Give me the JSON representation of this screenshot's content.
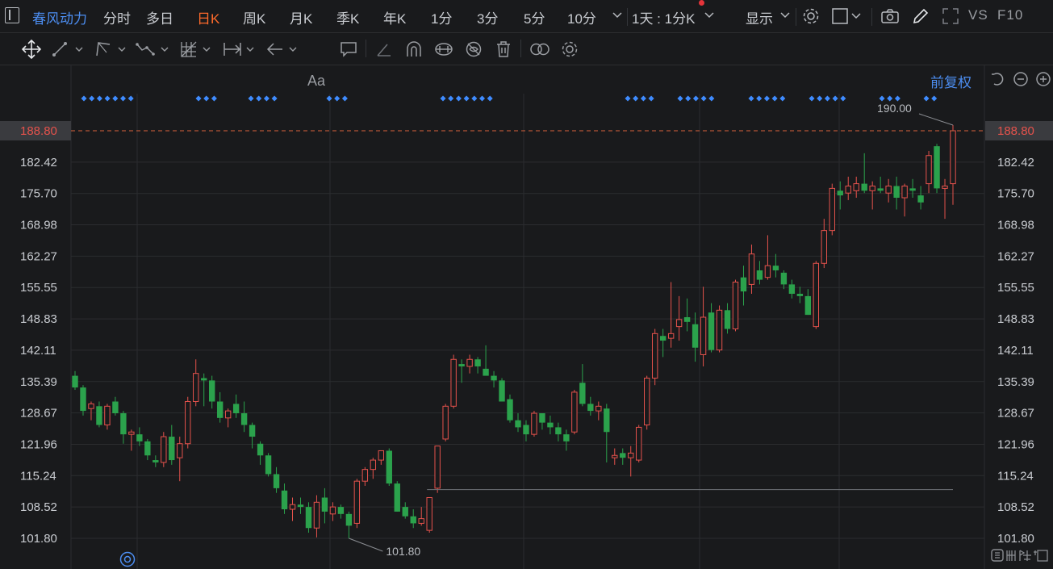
{
  "toolbar": {
    "stock_name": "春风动力",
    "periods": [
      "分时",
      "多日",
      "日K",
      "周K",
      "月K",
      "季K",
      "年K",
      "1分",
      "3分",
      "5分",
      "10分"
    ],
    "active_period": "日K",
    "combo": "1天 : 1分K",
    "display_label": "显示",
    "vs_label": "VS",
    "f10_label": "F10"
  },
  "drawing_tools": {
    "font_label": "Aa",
    "icons": [
      "move-icon",
      "line-segment-icon",
      "polyline-icon",
      "wave-icon",
      "fib-grid-icon",
      "measure-icon",
      "arrow-icon",
      "text-icon",
      "comment-icon",
      "angle-icon",
      "arc-icon",
      "magnet-icon",
      "hide-icon",
      "trash-icon",
      "link-icon",
      "settings-icon"
    ]
  },
  "adjust_label": "前复权",
  "colors": {
    "up": "#e5524c",
    "down": "#2ba24c",
    "accent": "#4c8df0",
    "active": "#ff6a2b",
    "grid": "#2b2c2f",
    "marker": "#3f8cff"
  },
  "chart_data": {
    "type": "candlestick",
    "y_ticks": [
      "188.80",
      "182.42",
      "175.70",
      "168.98",
      "162.27",
      "155.55",
      "148.83",
      "142.11",
      "135.39",
      "128.67",
      "121.96",
      "115.24",
      "108.52",
      "101.80"
    ],
    "ylim": [
      101.8,
      188.8
    ],
    "current_price": "188.80",
    "max_label": "190.00",
    "min_label": "101.80",
    "reference_line": 112.2,
    "candles": [
      [
        136.5,
        137.5,
        133.5,
        134.0
      ],
      [
        134.0,
        134.5,
        128.0,
        129.0
      ],
      [
        129.5,
        131.0,
        127.0,
        130.5
      ],
      [
        130.0,
        131.0,
        125.5,
        126.0
      ],
      [
        126.0,
        130.5,
        125.0,
        130.0
      ],
      [
        131.0,
        132.0,
        128.0,
        128.5
      ],
      [
        128.5,
        129.0,
        122.0,
        124.0
      ],
      [
        124.0,
        125.0,
        120.5,
        124.5
      ],
      [
        124.0,
        125.5,
        121.5,
        122.5
      ],
      [
        122.5,
        123.0,
        118.5,
        119.5
      ],
      [
        118.5,
        119.5,
        117.0,
        118.0
      ],
      [
        118.0,
        124.5,
        117.0,
        123.5
      ],
      [
        123.5,
        126.0,
        117.5,
        118.5
      ],
      [
        119.0,
        123.5,
        114.0,
        122.0
      ],
      [
        122.0,
        132.0,
        121.0,
        131.0
      ],
      [
        131.0,
        140.0,
        130.0,
        137.0
      ],
      [
        136.0,
        137.0,
        130.0,
        135.5
      ],
      [
        135.5,
        136.5,
        129.5,
        131.0
      ],
      [
        131.0,
        133.0,
        126.5,
        127.5
      ],
      [
        127.5,
        129.5,
        125.5,
        129.0
      ],
      [
        130.5,
        132.5,
        127.5,
        128.5
      ],
      [
        128.5,
        131.0,
        124.5,
        126.0
      ],
      [
        126.0,
        126.5,
        121.0,
        123.5
      ],
      [
        122.0,
        122.5,
        117.5,
        119.5
      ],
      [
        119.5,
        120.0,
        115.0,
        115.5
      ],
      [
        115.5,
        117.0,
        111.5,
        112.5
      ],
      [
        112.0,
        113.5,
        107.0,
        108.0
      ],
      [
        108.0,
        110.5,
        105.5,
        109.0
      ],
      [
        109.0,
        110.5,
        107.0,
        108.5
      ],
      [
        108.5,
        109.5,
        103.0,
        104.0
      ],
      [
        104.0,
        111.0,
        102.0,
        109.5
      ],
      [
        110.5,
        112.5,
        105.0,
        107.5
      ],
      [
        107.0,
        109.5,
        105.5,
        108.5
      ],
      [
        108.5,
        109.0,
        106.0,
        107.0
      ],
      [
        107.0,
        107.5,
        101.8,
        104.5
      ],
      [
        105.0,
        114.5,
        104.0,
        114.0
      ],
      [
        114.0,
        117.0,
        113.0,
        116.5
      ],
      [
        116.5,
        119.0,
        114.5,
        118.5
      ],
      [
        118.5,
        120.5,
        117.5,
        120.5
      ],
      [
        120.5,
        121.0,
        113.0,
        113.5
      ],
      [
        113.5,
        114.0,
        107.5,
        107.5
      ],
      [
        108.5,
        109.5,
        106.0,
        106.5
      ],
      [
        106.5,
        108.0,
        104.0,
        105.0
      ],
      [
        105.0,
        108.5,
        104.5,
        106.0
      ],
      [
        103.5,
        110.5,
        103.0,
        110.5
      ],
      [
        112.5,
        121.5,
        111.5,
        121.5
      ],
      [
        123.0,
        130.5,
        122.5,
        130.0
      ],
      [
        130.0,
        141.0,
        129.5,
        140.0
      ],
      [
        139.0,
        140.0,
        135.0,
        138.5
      ],
      [
        138.5,
        141.0,
        137.0,
        140.0
      ],
      [
        140.0,
        140.5,
        137.0,
        138.5
      ],
      [
        138.0,
        143.0,
        137.0,
        136.5
      ],
      [
        136.5,
        137.5,
        134.0,
        135.5
      ],
      [
        135.5,
        136.0,
        131.0,
        131.0
      ],
      [
        131.5,
        132.5,
        126.5,
        127.0
      ],
      [
        127.0,
        128.5,
        124.5,
        125.5
      ],
      [
        126.0,
        127.0,
        122.5,
        124.0
      ],
      [
        124.0,
        129.0,
        123.5,
        128.5
      ],
      [
        128.5,
        128.5,
        125.0,
        126.5
      ],
      [
        126.5,
        128.0,
        124.0,
        125.5
      ],
      [
        125.5,
        126.5,
        122.5,
        124.0
      ],
      [
        124.0,
        125.0,
        120.5,
        122.5
      ],
      [
        124.5,
        133.5,
        124.0,
        133.0
      ],
      [
        135.0,
        139.0,
        130.0,
        130.5
      ],
      [
        130.5,
        132.0,
        128.0,
        129.0
      ],
      [
        129.0,
        131.0,
        127.0,
        130.0
      ],
      [
        129.5,
        130.5,
        118.0,
        124.5
      ],
      [
        119.0,
        121.0,
        117.5,
        119.5
      ],
      [
        120.0,
        121.0,
        117.5,
        119.0
      ],
      [
        119.0,
        121.5,
        115.0,
        120.0
      ],
      [
        118.5,
        126.0,
        118.0,
        125.5
      ],
      [
        126.0,
        136.5,
        125.0,
        136.0
      ],
      [
        136.0,
        146.5,
        134.5,
        145.5
      ],
      [
        145.0,
        146.5,
        140.5,
        144.0
      ],
      [
        144.5,
        156.5,
        142.5,
        145.5
      ],
      [
        147.0,
        153.5,
        144.0,
        148.5
      ],
      [
        149.0,
        153.0,
        146.0,
        148.0
      ],
      [
        147.5,
        150.0,
        139.5,
        142.5
      ],
      [
        141.0,
        155.5,
        138.5,
        149.0
      ],
      [
        150.0,
        152.0,
        141.5,
        142.0
      ],
      [
        142.0,
        151.5,
        141.5,
        150.5
      ],
      [
        150.5,
        152.0,
        145.5,
        146.5
      ],
      [
        146.5,
        157.0,
        146.0,
        156.5
      ],
      [
        157.5,
        160.0,
        151.5,
        154.5
      ],
      [
        156.0,
        164.5,
        154.0,
        162.5
      ],
      [
        159.0,
        161.0,
        156.0,
        157.0
      ],
      [
        157.5,
        166.5,
        157.0,
        160.0
      ],
      [
        160.0,
        162.5,
        157.5,
        159.0
      ],
      [
        158.5,
        159.0,
        155.0,
        156.0
      ],
      [
        156.0,
        157.0,
        153.0,
        154.0
      ],
      [
        154.0,
        155.5,
        152.0,
        153.5
      ],
      [
        153.5,
        155.0,
        149.5,
        149.5
      ],
      [
        147.0,
        161.0,
        146.5,
        160.5
      ],
      [
        160.5,
        170.0,
        159.5,
        167.5
      ],
      [
        167.5,
        177.5,
        166.5,
        176.5
      ],
      [
        176.0,
        178.0,
        172.0,
        175.0
      ],
      [
        175.5,
        179.0,
        174.0,
        177.0
      ],
      [
        176.0,
        179.0,
        174.5,
        177.5
      ],
      [
        177.5,
        184.0,
        175.5,
        176.0
      ],
      [
        176.0,
        178.0,
        172.0,
        177.0
      ],
      [
        176.5,
        179.0,
        175.5,
        176.0
      ],
      [
        175.5,
        178.5,
        173.5,
        177.0
      ],
      [
        177.0,
        179.0,
        172.0,
        174.5
      ],
      [
        174.5,
        177.5,
        170.5,
        177.0
      ],
      [
        176.5,
        178.5,
        174.5,
        176.0
      ],
      [
        175.0,
        177.0,
        172.0,
        173.5
      ],
      [
        177.5,
        184.5,
        175.5,
        183.5
      ],
      [
        185.5,
        186.0,
        175.5,
        176.5
      ],
      [
        176.5,
        178.5,
        170.0,
        177.0
      ],
      [
        177.5,
        190.0,
        173.0,
        188.8
      ]
    ],
    "marker_groups": [
      7,
      3,
      4,
      3,
      7,
      4,
      5,
      5,
      5,
      3,
      2
    ]
  }
}
